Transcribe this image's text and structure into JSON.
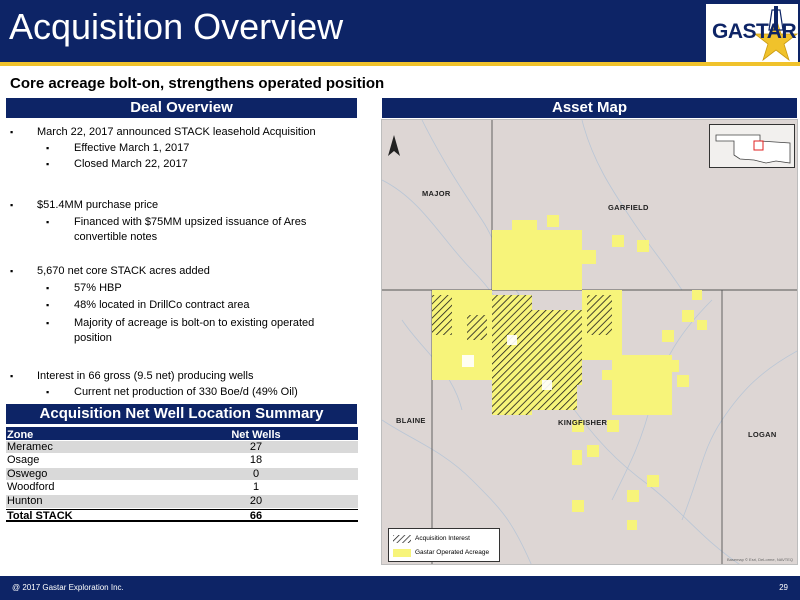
{
  "header": {
    "title": "Acquisition Overview",
    "logo_text": "GASTAR"
  },
  "subtitle": "Core acreage bolt-on, strengthens operated position",
  "deal_overview": {
    "title": "Deal Overview",
    "bullets": [
      {
        "text": "March 22, 2017 announced STACK leasehold Acquisition",
        "sub": [
          "Effective March 1, 2017",
          "Closed March 22, 2017"
        ]
      },
      {
        "text": "$51.4MM purchase price",
        "sub": [
          "Financed with $75MM upsized issuance of Ares convertible notes"
        ]
      },
      {
        "text": "5,670 net core STACK acres added",
        "sub": [
          "57% HBP",
          "48% located in DrillCo contract area",
          "Majority of acreage is bolt-on to existing operated position"
        ]
      },
      {
        "text": "Interest in 66 gross (9.5 net) producing wells",
        "sub": [
          "Current net production of 330 Boe/d (49% Oil)"
        ]
      }
    ]
  },
  "well_summary": {
    "title": "Acquisition Net Well Location Summary",
    "columns": [
      "Zone",
      "Net Wells"
    ],
    "rows": [
      [
        "Meramec",
        "27"
      ],
      [
        "Osage",
        "18"
      ],
      [
        "Oswego",
        "0"
      ],
      [
        "Woodford",
        "1"
      ],
      [
        "Hunton",
        "20"
      ]
    ],
    "total": [
      "Total STACK",
      "66"
    ]
  },
  "asset_map": {
    "title": "Asset Map",
    "counties": [
      "MAJOR",
      "GARFIELD",
      "BLAINE",
      "KINGFISHER",
      "LOGAN"
    ],
    "legend": [
      "Acquisition Interest",
      "Gastar Operated Acreage"
    ],
    "credit": "Basemap © Esri, DeLorme, NAVTEQ",
    "colors": {
      "operated_acreage": "#f7f47a",
      "acquisition_hatch": "#1a1a1a",
      "map_background": "#ddd6d4"
    },
    "icons": [
      "north-arrow-icon",
      "oklahoma-inset-map"
    ]
  },
  "footer": {
    "copyright": "@ 2017 Gastar Exploration Inc.",
    "page": "29"
  },
  "colors": {
    "navy": "#0d2466",
    "gold": "#f0c22b"
  }
}
